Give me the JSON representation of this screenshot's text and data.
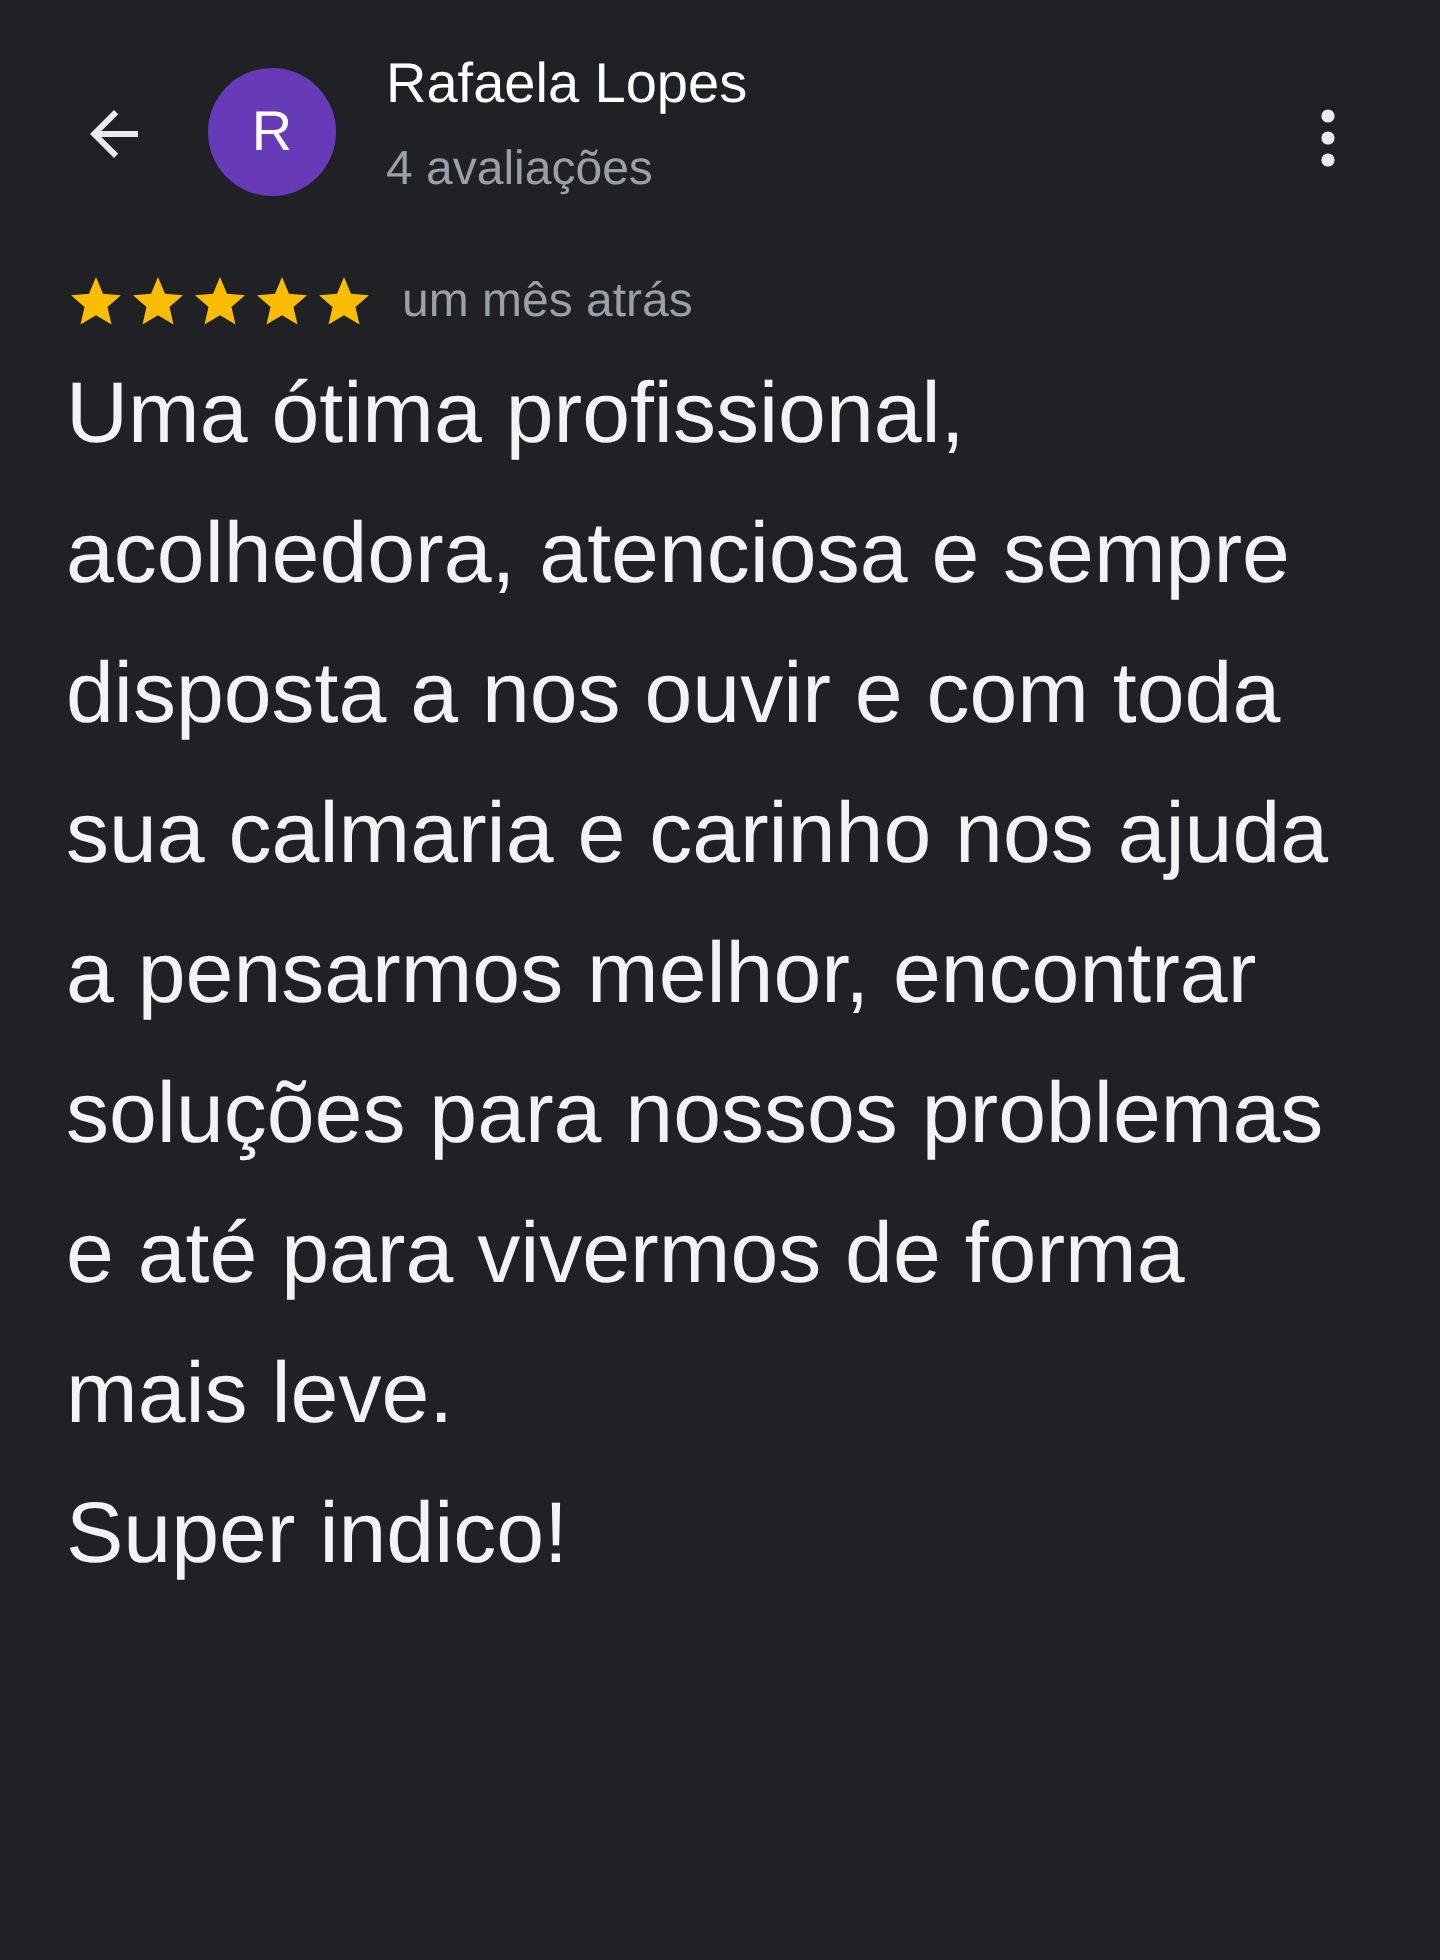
{
  "header": {
    "author": {
      "name": "Rafaela Lopes",
      "initial": "R",
      "reviews": "4 avaliações"
    }
  },
  "review": {
    "stars": 5,
    "time": "um mês atrás",
    "paragraphs": [
      "Uma ótima profissional, acolhedora, atenciosa e sempre disposta a nos ouvir e com toda sua calmaria e carinho nos ajuda a pensarmos melhor, encontrar soluções para nossos problemas e até para vivermos de forma mais leve.",
      "Super indico!"
    ]
  }
}
